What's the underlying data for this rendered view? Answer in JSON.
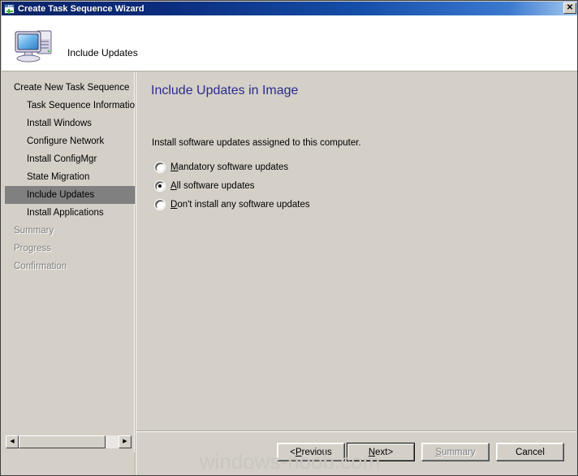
{
  "window": {
    "title": "Create Task Sequence Wizard",
    "title_icon": "window-plus-icon",
    "close_label": "✕"
  },
  "header": {
    "icon": "computer-icon",
    "text": "Include Updates"
  },
  "sidebar": {
    "items": [
      {
        "label": "Create New Task Sequence",
        "level": 0,
        "state": "normal"
      },
      {
        "label": "Task Sequence Informatio",
        "level": 1,
        "state": "normal"
      },
      {
        "label": "Install Windows",
        "level": 1,
        "state": "normal"
      },
      {
        "label": "Configure Network",
        "level": 1,
        "state": "normal"
      },
      {
        "label": "Install ConfigMgr",
        "level": 1,
        "state": "normal"
      },
      {
        "label": "State Migration",
        "level": 1,
        "state": "normal"
      },
      {
        "label": "Include Updates",
        "level": 1,
        "state": "selected"
      },
      {
        "label": "Install Applications",
        "level": 1,
        "state": "normal"
      },
      {
        "label": "Summary",
        "level": 0,
        "state": "disabled"
      },
      {
        "label": "Progress",
        "level": 0,
        "state": "disabled"
      },
      {
        "label": "Confirmation",
        "level": 0,
        "state": "disabled"
      }
    ],
    "scrollbar": {
      "left_arrow": "◀",
      "right_arrow": "▶"
    }
  },
  "main": {
    "page_title": "Include Updates in Image",
    "instruction": "Install software updates assigned to this computer.",
    "options": [
      {
        "label": "Mandatory software updates",
        "accel": "M",
        "rest": "andatory software updates",
        "selected": false
      },
      {
        "label": "All software updates",
        "accel": "A",
        "rest": "ll software updates",
        "selected": true
      },
      {
        "label": "Don't install any software updates",
        "accel": "D",
        "rest": "on't install any software updates",
        "selected": false
      }
    ]
  },
  "footer": {
    "buttons": [
      {
        "name": "previous",
        "prefix": "< ",
        "accel": "P",
        "rest": "revious",
        "suffix": "",
        "state": "normal"
      },
      {
        "name": "next",
        "prefix": "",
        "accel": "N",
        "rest": "ext",
        "suffix": " >",
        "state": "default"
      },
      {
        "name": "summary",
        "prefix": "",
        "accel": "S",
        "rest": "ummary",
        "suffix": "",
        "state": "disabled"
      },
      {
        "name": "cancel",
        "prefix": "",
        "accel": "",
        "rest": "Cancel",
        "suffix": "",
        "state": "normal"
      }
    ]
  },
  "watermark": {
    "text": "windows-noob.com"
  },
  "colors": {
    "titlebar_start": "#0a246a",
    "titlebar_end": "#a6caf0",
    "face": "#d4d0c8",
    "heading": "#2b2b8f",
    "selection": "#808080",
    "disabled_text": "#808080",
    "watermark": "#c9c6bf"
  }
}
